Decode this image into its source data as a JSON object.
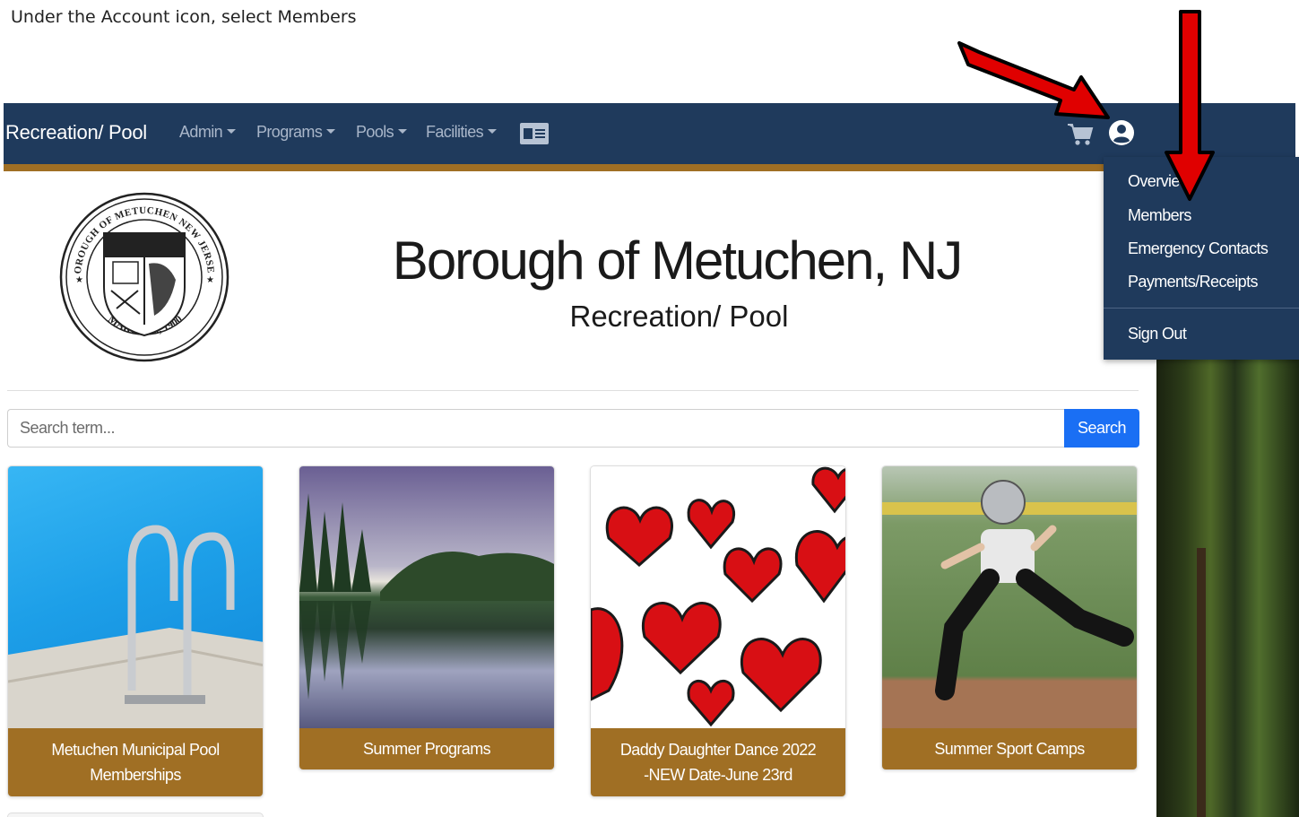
{
  "instruction": "Under the Account icon, select Members",
  "navbar": {
    "brand": "Recreation/ Pool",
    "items": [
      "Admin",
      "Programs",
      "Pools",
      "Facilities"
    ]
  },
  "account_menu": {
    "items": [
      "Overview",
      "Members",
      "Emergency Contacts",
      "Payments/Receipts"
    ],
    "sign_out": "Sign Out"
  },
  "header": {
    "seal_text_top": "BOROUGH OF METUCHEN NEW JERSEY",
    "seal_text_bottom": "MARCH 20, 1900",
    "title": "Borough of Metuchen, NJ",
    "subtitle": "Recreation/ Pool"
  },
  "search": {
    "placeholder": "Search term...",
    "button": "Search"
  },
  "cards": [
    {
      "line1": "Metuchen Municipal Pool",
      "line2": "Memberships"
    },
    {
      "line1": "Summer Programs",
      "line2": ""
    },
    {
      "line1": "Daddy Daughter Dance 2022",
      "line2": "-NEW Date-June 23rd"
    },
    {
      "line1": "Summer Sport Camps",
      "line2": ""
    }
  ],
  "colors": {
    "navbar": "#1f3a5c",
    "gold": "#a06f24",
    "search_button": "#1a6ff4",
    "annotation_arrow": "#e00000"
  }
}
